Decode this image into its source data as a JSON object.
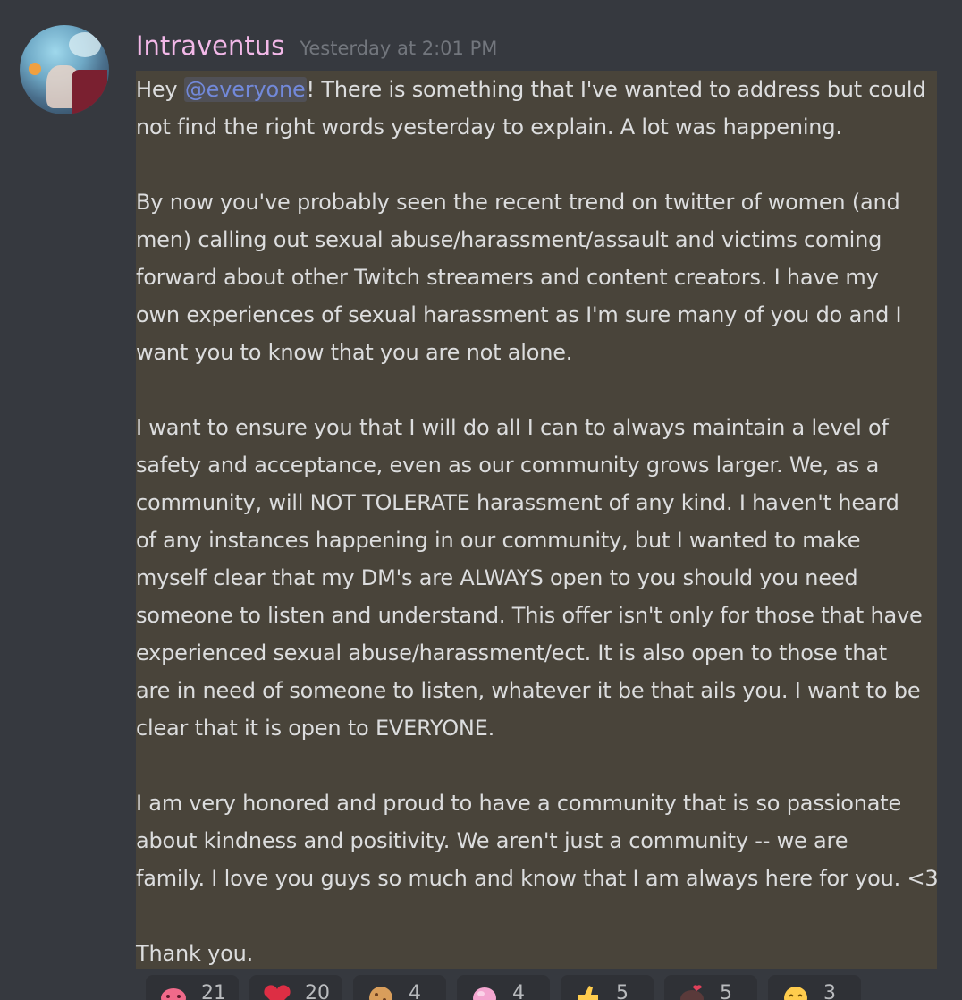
{
  "message": {
    "author": "Intraventus",
    "timestamp": "Yesterday at 2:01 PM",
    "avatar_icon": "user-avatar",
    "mention": "@everyone",
    "paragraphs": [
      {
        "first_line_prefix": "Hey ",
        "first_line_suffix": "! There is something that I've wanted to address but could",
        "lines": [
          "not find the right words yesterday to explain. A lot was happening."
        ]
      },
      {
        "lines": [
          "By now you've probably seen the recent trend on twitter of women (and",
          "men) calling out sexual abuse/harassment/assault and victims coming",
          "forward about other Twitch streamers and content creators. I have my",
          "own experiences of sexual harassment as I'm sure many of you do and I",
          "want you to know that you are not alone."
        ]
      },
      {
        "lines": [
          "I want to ensure you that I will do all I can to always maintain a level of",
          "safety and acceptance, even as our community grows larger. We, as a",
          "community, will NOT TOLERATE harassment of any kind. I haven't heard",
          "of any instances happening in our community, but I wanted to make",
          "myself clear that my DM's are ALWAYS open to you should you need",
          "someone to listen and understand. This offer isn't only for those that have",
          "experienced sexual abuse/harassment/ect. It is also open to those that",
          "are in need of someone to listen, whatever it be that ails you. I want to be",
          "clear that it is open to EVERYONE."
        ]
      },
      {
        "lines": [
          "I am very honored and proud to have a community that is so passionate",
          "about kindness and positivity. We aren't just a community -- we are",
          "family. I love you guys so much and know that I am always here for you. <3"
        ]
      },
      {
        "lines": [
          "Thank you."
        ]
      }
    ]
  },
  "reactions": [
    {
      "icon": "pink-heart-creature-emoji",
      "color": "#f06a8a",
      "count": "21"
    },
    {
      "icon": "red-heart-emoji",
      "color": "#dd2e44",
      "count": "20"
    },
    {
      "icon": "cookie-emoji",
      "color": "#d99e5b",
      "count": "4"
    },
    {
      "icon": "pink-blob-emoji",
      "color": "#f4a6d0",
      "count": "4"
    },
    {
      "icon": "thumbs-up-emoji",
      "color": "#ffcc4d",
      "count": "5"
    },
    {
      "icon": "dark-heart-creature-emoji",
      "color": "#5a3a3a",
      "count": "5"
    },
    {
      "icon": "smiling-face-emoji",
      "color": "#ffcc4d",
      "count": "3"
    }
  ],
  "colors": {
    "background": "#36393f",
    "highlight": "#49443a",
    "username": "#f2b8e8",
    "mention": "#7289da",
    "text": "#dcddde",
    "timestamp": "#72767d"
  }
}
